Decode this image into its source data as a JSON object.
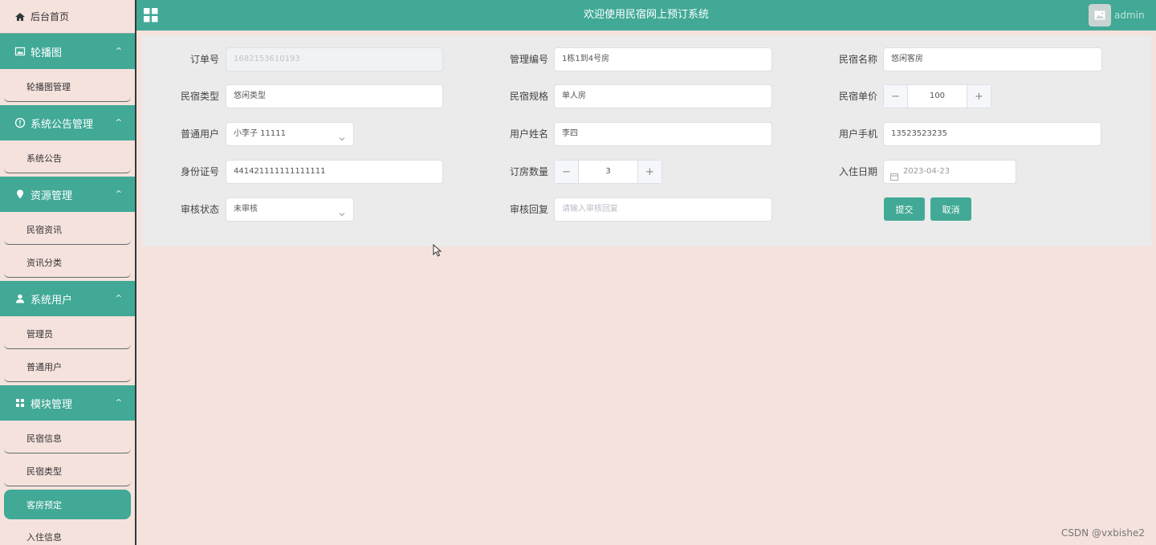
{
  "sidebar": {
    "home": "后台首页",
    "groups": [
      {
        "label": "轮播图",
        "items": [
          "轮播图管理"
        ]
      },
      {
        "label": "系统公告管理",
        "items": [
          "系统公告"
        ]
      },
      {
        "label": "资源管理",
        "items": [
          "民宿资讯",
          "资讯分类"
        ]
      },
      {
        "label": "系统用户",
        "items": [
          "管理员",
          "普通用户"
        ]
      },
      {
        "label": "模块管理",
        "items": [
          "民宿信息",
          "民宿类型",
          "客房预定",
          "入住信息"
        ]
      }
    ],
    "active_item": "客房预定"
  },
  "header": {
    "title": "欢迎使用民宿网上预订系统",
    "user": "admin"
  },
  "form": {
    "order_no": {
      "label": "订单号",
      "value": "1682153610193"
    },
    "manager_no": {
      "label": "管理编号",
      "value": "1栋1到4号房"
    },
    "homestay_name": {
      "label": "民宿名称",
      "value": "悠闲客房"
    },
    "homestay_type": {
      "label": "民宿类型",
      "value": "悠闲类型"
    },
    "homestay_spec": {
      "label": "民宿规格",
      "value": "单人房"
    },
    "unit_price": {
      "label": "民宿单价",
      "value": "100",
      "minus": "−",
      "plus": "+"
    },
    "user_account": {
      "label": "普通用户",
      "value": "小李子 11111"
    },
    "user_name": {
      "label": "用户姓名",
      "value": "李四"
    },
    "user_phone": {
      "label": "用户手机",
      "value": "13523523235"
    },
    "id_number": {
      "label": "身份证号",
      "value": "441421111111111111"
    },
    "room_count": {
      "label": "订房数量",
      "value": "3",
      "minus": "−",
      "plus": "+"
    },
    "checkin_date": {
      "label": "入住日期",
      "value": "2023-04-23"
    },
    "review_status": {
      "label": "审核状态",
      "value": "未审核"
    },
    "review_reply": {
      "label": "审核回复",
      "placeholder": "请输入审核回复"
    },
    "submit": "提交",
    "cancel": "取消"
  },
  "watermark": "CSDN @vxbishe2",
  "colors": {
    "accent": "#41a996",
    "background": "#f5e2dd",
    "panel": "#ebebeb"
  }
}
